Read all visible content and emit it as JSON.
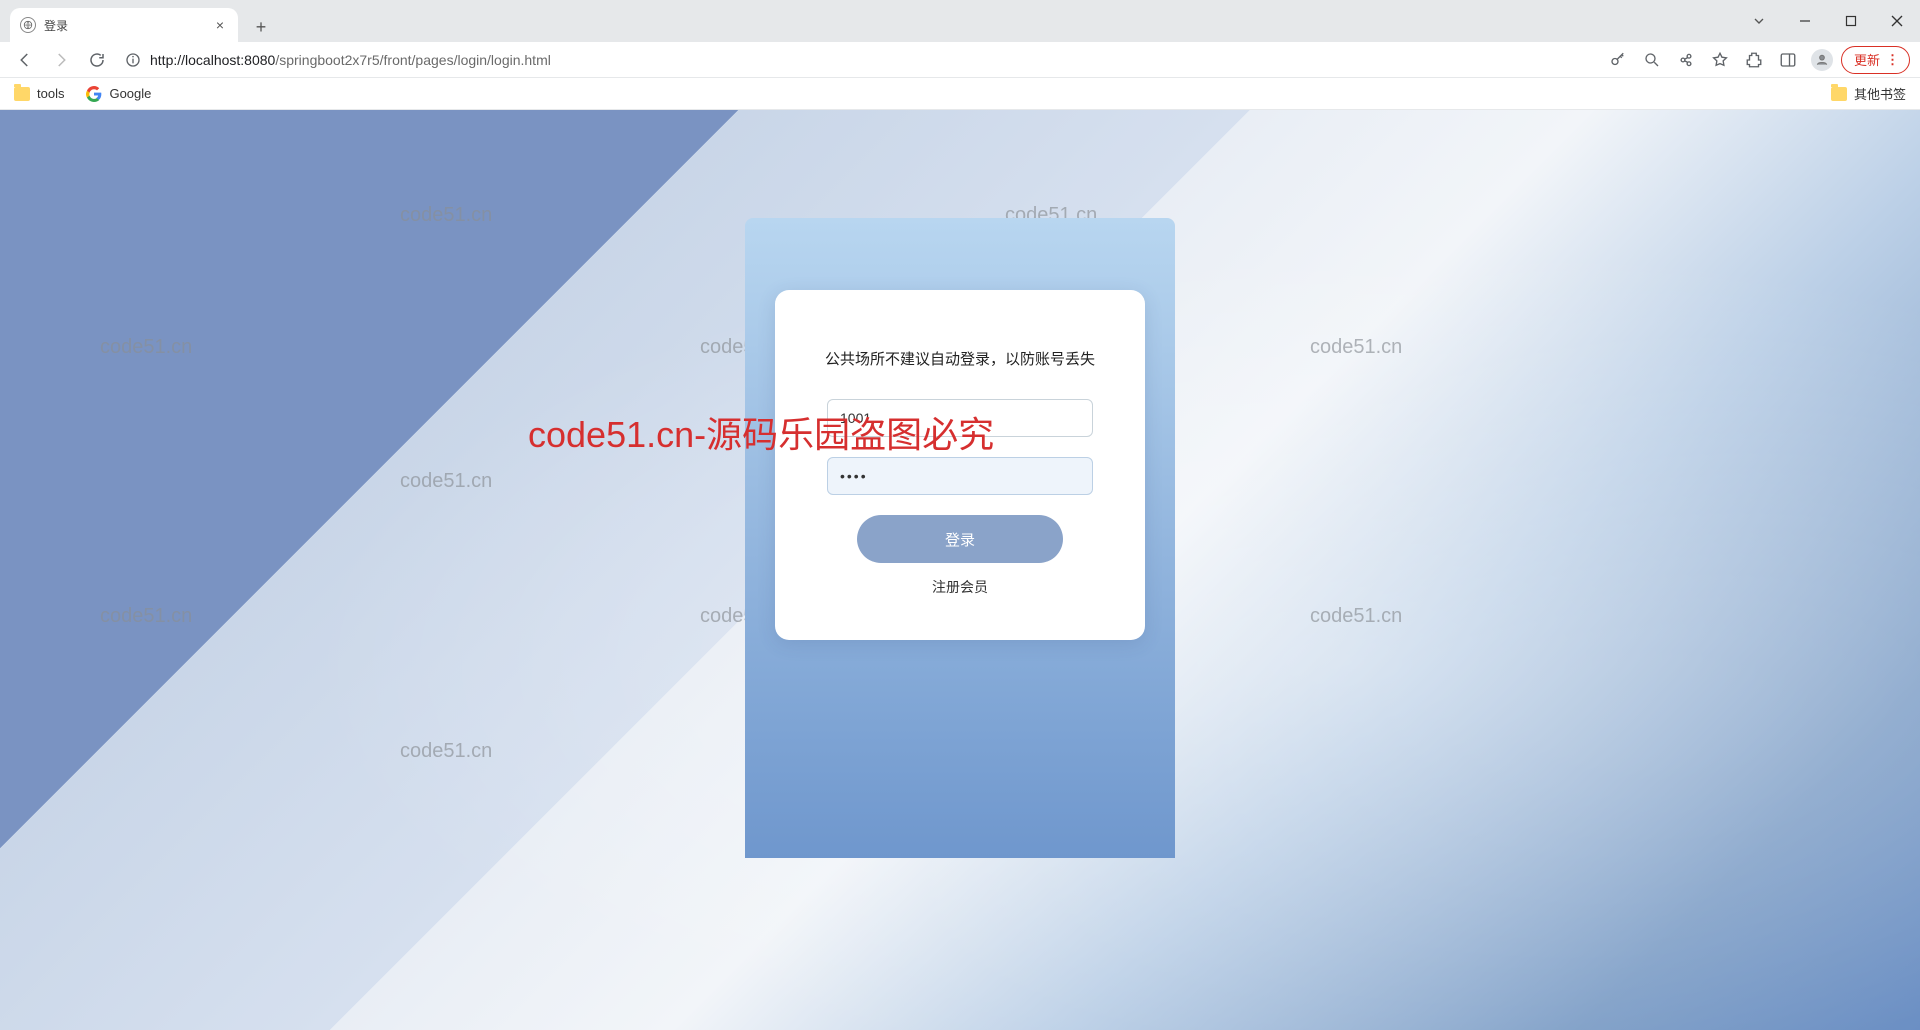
{
  "browser": {
    "tab_title": "登录",
    "url_host": "localhost",
    "url_port": ":8080",
    "url_path": "/springboot2x7r5/front/pages/login/login.html",
    "url_scheme": "http://",
    "update_label": "更新"
  },
  "bookmarks": {
    "tools": "tools",
    "google": "Google",
    "other": "其他书签"
  },
  "login": {
    "tip": "公共场所不建议自动登录，以防账号丢失",
    "username_value": "1001",
    "password_value": "••••",
    "login_button": "登录",
    "register_link": "注册会员"
  },
  "watermarks": {
    "small": "code51.cn",
    "big": "code51.cn-源码乐园盗图必究"
  }
}
